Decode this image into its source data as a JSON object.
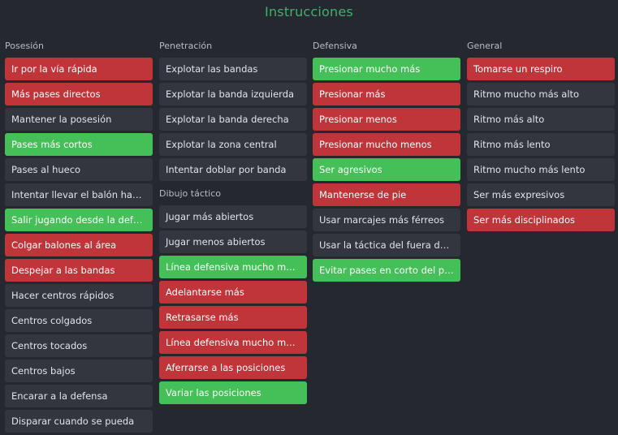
{
  "title": "Instrucciones",
  "columns": [
    {
      "header": "Posesión",
      "items": [
        {
          "label": "Ir por la vía rápida",
          "state": "red"
        },
        {
          "label": "Más pases directos",
          "state": "red"
        },
        {
          "label": "Mantener la posesión",
          "state": "off"
        },
        {
          "label": "Pases más cortos",
          "state": "green"
        },
        {
          "label": "Pases al hueco",
          "state": "off"
        },
        {
          "label": "Intentar llevar el balón hasta la portería",
          "state": "off"
        },
        {
          "label": "Salir jugando desde la defensa",
          "state": "green"
        },
        {
          "label": "Colgar balones al área",
          "state": "red"
        },
        {
          "label": "Despejar a las bandas",
          "state": "red"
        },
        {
          "label": "Hacer centros rápidos",
          "state": "off"
        },
        {
          "label": "Centros colgados",
          "state": "off"
        },
        {
          "label": "Centros tocados",
          "state": "off"
        },
        {
          "label": "Centros bajos",
          "state": "off"
        },
        {
          "label": "Encarar a la defensa",
          "state": "off"
        },
        {
          "label": "Disparar cuando se pueda",
          "state": "off"
        }
      ]
    },
    {
      "header": "Penetración",
      "items": [
        {
          "label": "Explotar las bandas",
          "state": "off"
        },
        {
          "label": "Explotar la banda izquierda",
          "state": "off"
        },
        {
          "label": "Explotar la banda derecha",
          "state": "off"
        },
        {
          "label": "Explotar la zona central",
          "state": "off"
        },
        {
          "label": "Intentar doblar por banda",
          "state": "off"
        }
      ],
      "subheader": "Dibujo táctico",
      "subitems": [
        {
          "label": "Jugar más abiertos",
          "state": "off"
        },
        {
          "label": "Jugar menos abiertos",
          "state": "off"
        },
        {
          "label": "Línea defensiva mucho más adelantada",
          "state": "green"
        },
        {
          "label": "Adelantarse más",
          "state": "red"
        },
        {
          "label": "Retrasarse más",
          "state": "red"
        },
        {
          "label": "Línea defensiva mucho más retrasada",
          "state": "red"
        },
        {
          "label": "Aferrarse a las posiciones",
          "state": "red"
        },
        {
          "label": "Variar las posiciones",
          "state": "green"
        }
      ]
    },
    {
      "header": "Defensiva",
      "items": [
        {
          "label": "Presionar mucho más",
          "state": "green"
        },
        {
          "label": "Presionar más",
          "state": "red"
        },
        {
          "label": "Presionar menos",
          "state": "red"
        },
        {
          "label": "Presionar mucho menos",
          "state": "red"
        },
        {
          "label": "Ser agresivos",
          "state": "green"
        },
        {
          "label": "Mantenerse de pie",
          "state": "red"
        },
        {
          "label": "Usar marcajes más férreos",
          "state": "off"
        },
        {
          "label": "Usar la táctica del fuera de juego",
          "state": "off"
        },
        {
          "label": "Evitar pases en corto del portero",
          "state": "green"
        }
      ]
    },
    {
      "header": "General",
      "items": [
        {
          "label": "Tomarse un respiro",
          "state": "red"
        },
        {
          "label": "Ritmo mucho más alto",
          "state": "off"
        },
        {
          "label": "Ritmo más alto",
          "state": "off"
        },
        {
          "label": "Ritmo más lento",
          "state": "off"
        },
        {
          "label": "Ritmo mucho más lento",
          "state": "off"
        },
        {
          "label": "Ser más expresivos",
          "state": "off"
        },
        {
          "label": "Ser más disciplinados",
          "state": "red"
        }
      ]
    }
  ],
  "colors": {
    "background": "#262830",
    "title": "#3fb070",
    "item_default": "#34363f",
    "item_red": "#c0353a",
    "item_green": "#45c058"
  }
}
